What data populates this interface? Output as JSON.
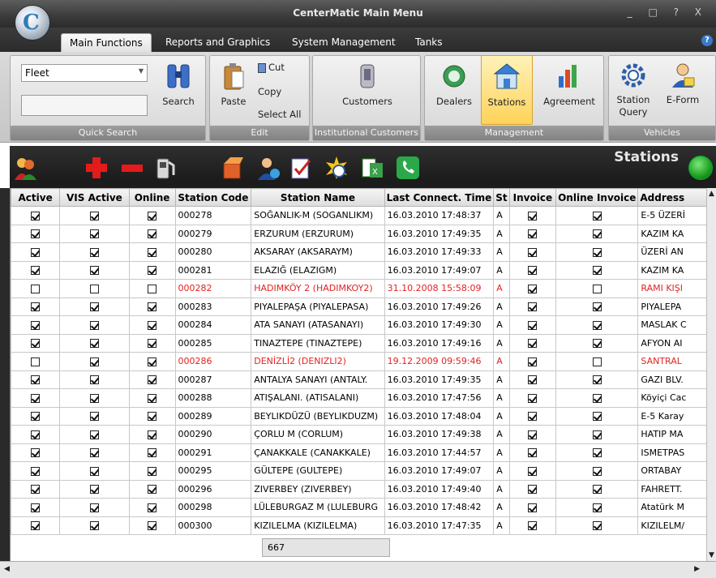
{
  "window": {
    "title": "CenterMatic Main Menu",
    "controls": "_ □ ? X"
  },
  "tabs": [
    {
      "label": "Main Functions",
      "active": true
    },
    {
      "label": "Reports and Graphics"
    },
    {
      "label": "System Management"
    },
    {
      "label": "Tanks"
    }
  ],
  "help": "?",
  "ribbon": {
    "quick_search": {
      "select_value": "Fleet",
      "search_label": "Search",
      "group_label": "Quick Search"
    },
    "edit": {
      "paste": "Paste",
      "cut": "Cut",
      "copy": "Copy",
      "select_all": "Select All",
      "group_label": "Edit"
    },
    "institutional": {
      "customers": "Customers",
      "group_label": "Institutional Customers"
    },
    "management": {
      "dealers": "Dealers",
      "stations": "Stations",
      "agreement": "Agreement",
      "group_label": "Management"
    },
    "vehicles": {
      "station_query": "Station Query",
      "eform": "E-Form",
      "group_label": "Vehicles"
    }
  },
  "panel": {
    "title": "Stations"
  },
  "grid": {
    "columns": [
      "Active",
      "VIS Active",
      "Online",
      "Station Code",
      "Station Name",
      "Last Connect. Time",
      "St",
      "Invoice",
      "Online Invoice",
      "Address"
    ],
    "rows": [
      {
        "active": true,
        "vis": true,
        "online": true,
        "code": "000278",
        "name": "SOĞANLIK-M (SOGANLIKM)",
        "time": "16.03.2010 17:48:37",
        "st": "A",
        "invoice": true,
        "online_invoice": true,
        "address": "E-5 ÜZERİ"
      },
      {
        "active": true,
        "vis": true,
        "online": true,
        "code": "000279",
        "name": "ERZURUM (ERZURUM)",
        "time": "16.03.2010 17:49:35",
        "st": "A",
        "invoice": true,
        "online_invoice": true,
        "address": "KAZIM KA"
      },
      {
        "active": true,
        "vis": true,
        "online": true,
        "code": "000280",
        "name": "AKSARAY (AKSARAYM)",
        "time": "16.03.2010 17:49:33",
        "st": "A",
        "invoice": true,
        "online_invoice": true,
        "address": "ÜZERİ AN"
      },
      {
        "active": true,
        "vis": true,
        "online": true,
        "code": "000281",
        "name": "ELAZIĞ (ELAZIGM)",
        "time": "16.03.2010 17:49:07",
        "st": "A",
        "invoice": true,
        "online_invoice": true,
        "address": "KAZIM KA"
      },
      {
        "active": false,
        "vis": false,
        "online": false,
        "code": "000282",
        "name": "HADIMKÖY 2 (HADIMKOY2)",
        "time": "31.10.2008 15:58:09",
        "st": "A",
        "invoice": true,
        "online_invoice": false,
        "address": "RAMI KIŞI",
        "red": true
      },
      {
        "active": true,
        "vis": true,
        "online": true,
        "code": "000283",
        "name": "PIYALEPAŞA (PIYALEPASA)",
        "time": "16.03.2010 17:49:26",
        "st": "A",
        "invoice": true,
        "online_invoice": true,
        "address": "PIYALEPA"
      },
      {
        "active": true,
        "vis": true,
        "online": true,
        "code": "000284",
        "name": "ATA SANAYI (ATASANAYI)",
        "time": "16.03.2010 17:49:30",
        "st": "A",
        "invoice": true,
        "online_invoice": true,
        "address": "MASLAK C"
      },
      {
        "active": true,
        "vis": true,
        "online": true,
        "code": "000285",
        "name": "TINAZTEPE (TINAZTEPE)",
        "time": "16.03.2010 17:49:16",
        "st": "A",
        "invoice": true,
        "online_invoice": true,
        "address": "AFYON AI"
      },
      {
        "active": false,
        "vis": true,
        "online": true,
        "code": "000286",
        "name": "DENİZLİ2 (DENIZLI2)",
        "time": "19.12.2009 09:59:46",
        "st": "A",
        "invoice": true,
        "online_invoice": false,
        "address": "SANTRAL",
        "red": true
      },
      {
        "active": true,
        "vis": true,
        "online": true,
        "code": "000287",
        "name": "ANTALYA SANAYI (ANTALY.",
        "time": "16.03.2010 17:49:35",
        "st": "A",
        "invoice": true,
        "online_invoice": true,
        "address": "GAZI BLV."
      },
      {
        "active": true,
        "vis": true,
        "online": true,
        "code": "000288",
        "name": "ATIŞALANI. (ATISALANI)",
        "time": "16.03.2010 17:47:56",
        "st": "A",
        "invoice": true,
        "online_invoice": true,
        "address": "Köyiçi Cac"
      },
      {
        "active": true,
        "vis": true,
        "online": true,
        "code": "000289",
        "name": "BEYLIKDÜZÜ (BEYLIKDUZM)",
        "time": "16.03.2010 17:48:04",
        "st": "A",
        "invoice": true,
        "online_invoice": true,
        "address": "E-5 Karay"
      },
      {
        "active": true,
        "vis": true,
        "online": true,
        "code": "000290",
        "name": "ÇORLU M (CORLUM)",
        "time": "16.03.2010 17:49:38",
        "st": "A",
        "invoice": true,
        "online_invoice": true,
        "address": "HATIP MA"
      },
      {
        "active": true,
        "vis": true,
        "online": true,
        "code": "000291",
        "name": "ÇANAKKALE (CANAKKALE)",
        "time": "16.03.2010 17:44:57",
        "st": "A",
        "invoice": true,
        "online_invoice": true,
        "address": "ISMETPAS"
      },
      {
        "active": true,
        "vis": true,
        "online": true,
        "code": "000295",
        "name": "GÜLTEPE (GULTEPE)",
        "time": "16.03.2010 17:49:07",
        "st": "A",
        "invoice": true,
        "online_invoice": true,
        "address": "ORTABAY"
      },
      {
        "active": true,
        "vis": true,
        "online": true,
        "code": "000296",
        "name": "ZIVERBEY (ZIVERBEY)",
        "time": "16.03.2010 17:49:40",
        "st": "A",
        "invoice": true,
        "online_invoice": true,
        "address": "FAHRETT."
      },
      {
        "active": true,
        "vis": true,
        "online": true,
        "code": "000298",
        "name": "LÜLEBURGAZ M (LULEBURG",
        "time": "16.03.2010 17:48:42",
        "st": "A",
        "invoice": true,
        "online_invoice": true,
        "address": "Atatürk M"
      },
      {
        "active": true,
        "vis": true,
        "online": true,
        "code": "000300",
        "name": "KIZILELMA (KIZILELMA)",
        "time": "16.03.2010 17:47:35",
        "st": "A",
        "invoice": true,
        "online_invoice": true,
        "address": "KIZILELM/"
      }
    ],
    "footer_count": "667"
  }
}
